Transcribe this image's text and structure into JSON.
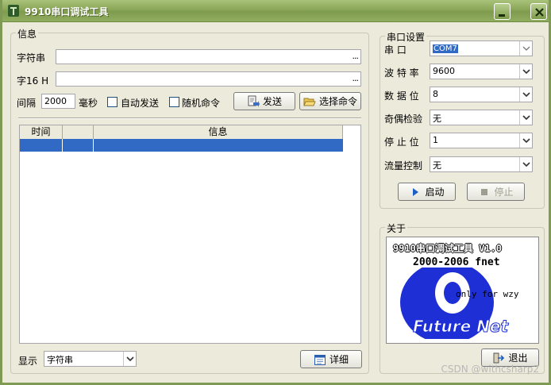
{
  "window": {
    "title": "9910串口调试工具"
  },
  "info": {
    "group_title": "信息",
    "string_label": "字符串",
    "hex_label": "字16 H",
    "ellipsis": "...",
    "interval_label": "间隔",
    "interval_value": "2000",
    "ms_label": "毫秒",
    "auto_send_label": "自动发送",
    "random_cmd_label": "随机命令",
    "send_button": "发送",
    "choose_cmd_button": "选择命令",
    "table": {
      "columns": [
        "时间",
        "",
        "信息"
      ]
    },
    "display_label": "显示",
    "display_value": "字符串",
    "detail_button": "详细"
  },
  "port": {
    "group_title": "串口设置",
    "fields": [
      {
        "label": "串   口",
        "value": "COM7"
      },
      {
        "label": "波 特 率",
        "value": "9600"
      },
      {
        "label": "数 据 位",
        "value": "8"
      },
      {
        "label": "奇偶检验",
        "value": "无"
      },
      {
        "label": "停 止 位",
        "value": "1"
      },
      {
        "label": "流量控制",
        "value": "无"
      }
    ],
    "start_button": "启动",
    "stop_button": "停止"
  },
  "about": {
    "group_title": "关于",
    "line1": "9910串口调试工具 V1.0",
    "line2": "2000-2006 fnet",
    "line3": "only for wzy",
    "logo_text": "Future Net",
    "exit_button": "退出"
  },
  "watermark": "CSDN @withcsharp2",
  "colors": {
    "title_bar": "#8aa657",
    "selection": "#316ac5",
    "logo_blue": "#1e2fd6"
  }
}
